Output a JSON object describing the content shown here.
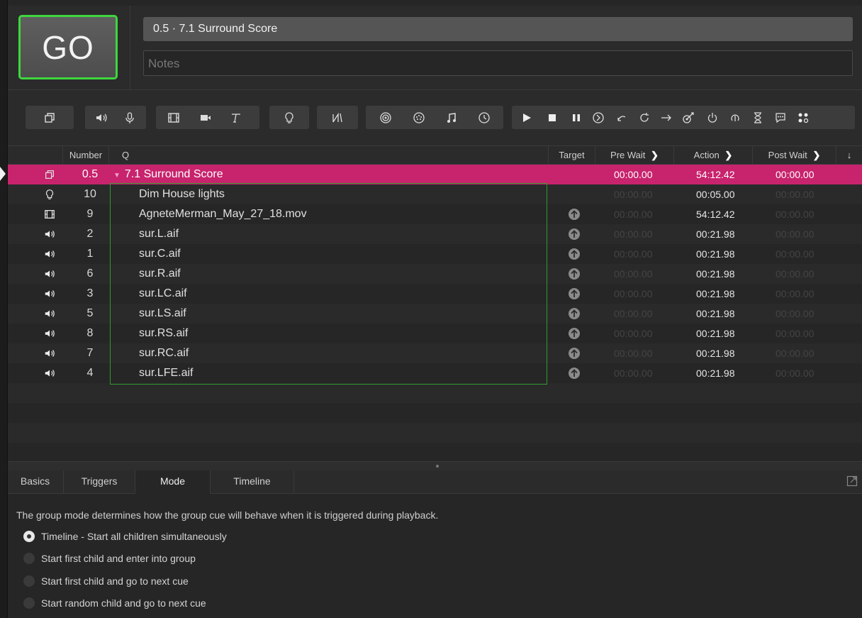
{
  "header": {
    "go_label": "GO",
    "cue_title": "0.5 · 7.1 Surround Score",
    "notes_placeholder": "Notes"
  },
  "toolbar": {
    "icons": [
      "group-icon",
      "audio-icon",
      "mic-icon",
      "video-icon",
      "camera-icon",
      "text-icon",
      "light-icon",
      "fade-icon",
      "network-icon",
      "midi-icon",
      "music-icon",
      "timecode-icon",
      "play-icon",
      "stop-icon",
      "pause-icon",
      "load-icon",
      "reset-icon",
      "devamp-icon",
      "goto-icon",
      "target-icon",
      "arm-icon",
      "disarm-icon",
      "wait-icon",
      "memo-icon",
      "script-icon"
    ]
  },
  "table": {
    "columns": [
      "Number",
      "Q",
      "Target",
      "Pre Wait",
      "Action",
      "Post Wait"
    ],
    "rows": [
      {
        "icon": "group-icon",
        "number": "0.5",
        "name": "7.1 Surround Score",
        "target": false,
        "pre": "00:00.00",
        "action": "54:12.42",
        "post": "00:00.00",
        "selected": true
      },
      {
        "icon": "light-icon",
        "number": "10",
        "name": "Dim House lights",
        "target": false,
        "pre": "00:00.00",
        "action": "00:05.00",
        "post": "00:00.00"
      },
      {
        "icon": "video-icon",
        "number": "9",
        "name": "AgneteMerman_May_27_18.mov",
        "target": true,
        "pre": "00:00.00",
        "action": "54:12.42",
        "post": "00:00.00"
      },
      {
        "icon": "audio-icon",
        "number": "2",
        "name": "sur.L.aif",
        "target": true,
        "pre": "00:00.00",
        "action": "00:21.98",
        "post": "00:00.00"
      },
      {
        "icon": "audio-icon",
        "number": "1",
        "name": "sur.C.aif",
        "target": true,
        "pre": "00:00.00",
        "action": "00:21.98",
        "post": "00:00.00"
      },
      {
        "icon": "audio-icon",
        "number": "6",
        "name": "sur.R.aif",
        "target": true,
        "pre": "00:00.00",
        "action": "00:21.98",
        "post": "00:00.00"
      },
      {
        "icon": "audio-icon",
        "number": "3",
        "name": "sur.LC.aif",
        "target": true,
        "pre": "00:00.00",
        "action": "00:21.98",
        "post": "00:00.00"
      },
      {
        "icon": "audio-icon",
        "number": "5",
        "name": "sur.LS.aif",
        "target": true,
        "pre": "00:00.00",
        "action": "00:21.98",
        "post": "00:00.00"
      },
      {
        "icon": "audio-icon",
        "number": "8",
        "name": "sur.RS.aif",
        "target": true,
        "pre": "00:00.00",
        "action": "00:21.98",
        "post": "00:00.00"
      },
      {
        "icon": "audio-icon",
        "number": "7",
        "name": "sur.RC.aif",
        "target": true,
        "pre": "00:00.00",
        "action": "00:21.98",
        "post": "00:00.00"
      },
      {
        "icon": "audio-icon",
        "number": "4",
        "name": "sur.LFE.aif",
        "target": true,
        "pre": "00:00.00",
        "action": "00:21.98",
        "post": "00:00.00"
      }
    ]
  },
  "inspector": {
    "tabs": [
      "Basics",
      "Triggers",
      "Mode",
      "Timeline"
    ],
    "active_tab": "Mode",
    "description": "The group mode determines how the group cue will behave when it is triggered during playback.",
    "options": [
      {
        "label": "Timeline - Start all children simultaneously",
        "selected": true
      },
      {
        "label": "Start first child and enter into group",
        "selected": false
      },
      {
        "label": "Start first child and go to next cue",
        "selected": false
      },
      {
        "label": "Start random child and go to next cue",
        "selected": false
      }
    ]
  },
  "colors": {
    "selection": "#c8236d",
    "go_border": "#3fd63f",
    "group_outline": "#2f9b2f"
  }
}
